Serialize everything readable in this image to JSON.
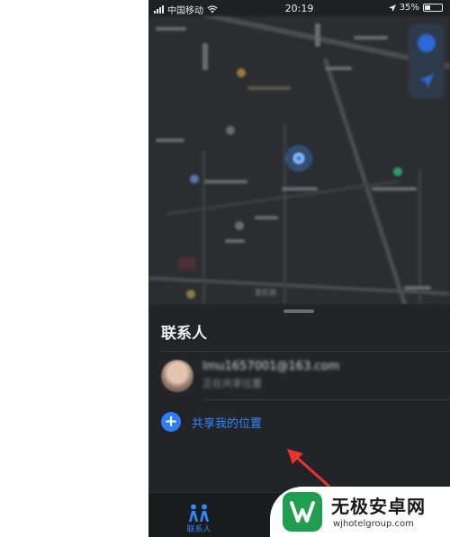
{
  "status_bar": {
    "carrier": "中国移动",
    "time": "20:19",
    "battery_percent": "35%",
    "battery_level": 0.35
  },
  "sheet": {
    "title": "联系人",
    "contact": {
      "name": "lmu1657001@163.com",
      "subtitle": "正在共享位置"
    },
    "share_label": "共享我的位置"
  },
  "tabbar": {
    "people_label": "联系人"
  },
  "map": {
    "street_label": "爱民路"
  },
  "watermark": {
    "title": "无极安卓网",
    "url": "wjhotelgroup.com"
  },
  "colors": {
    "accent": "#2f86ff",
    "sheet_bg": "#232427",
    "map_bg": "#2b2d30",
    "annotation_arrow": "#e8342f",
    "watermark_green": "#1f9e4f"
  }
}
